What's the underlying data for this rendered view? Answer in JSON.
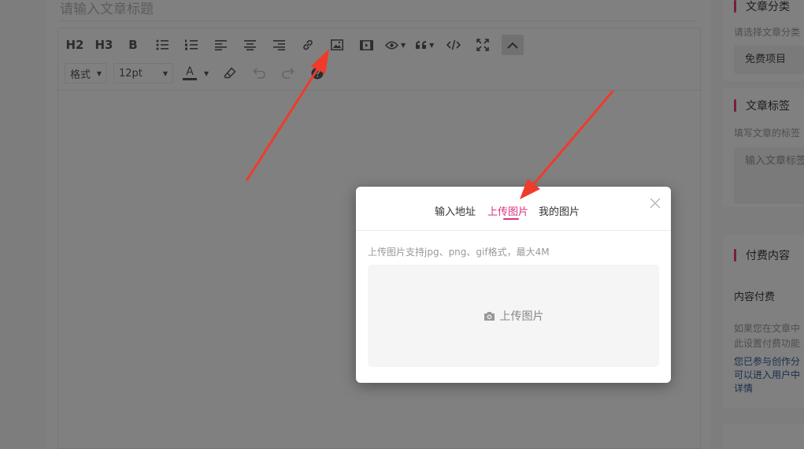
{
  "editor": {
    "title_placeholder": "请输入文章标题",
    "toolbar": {
      "h2": "H2",
      "h3": "H3",
      "bold": "B",
      "format_select": "格式",
      "size_select": "12pt",
      "font_color_letter": "A"
    }
  },
  "sidebar": {
    "category": {
      "title": "文章分类",
      "hint": "请选择文章分类",
      "value": "免费项目"
    },
    "tags": {
      "title": "文章标签",
      "hint": "填写文章的标签",
      "placeholder": "输入文章标签"
    },
    "paid": {
      "title": "付费内容",
      "label": "内容付费",
      "desc_line1": "如果您在文章中",
      "desc_line2": "此设置付费功能",
      "link_line1": "您已参与创作分",
      "link_line2": "可以进入用户中",
      "link_line3": "详情"
    }
  },
  "modal": {
    "tabs": [
      "输入地址",
      "上传图片",
      "我的图片"
    ],
    "active_tab": "上传图片",
    "support_text": "上传图片支持jpg、png、gif格式，最大4M",
    "upload_label": "上传图片"
  },
  "colors": {
    "accent": "#d63383",
    "arrow": "#f03a2a"
  }
}
